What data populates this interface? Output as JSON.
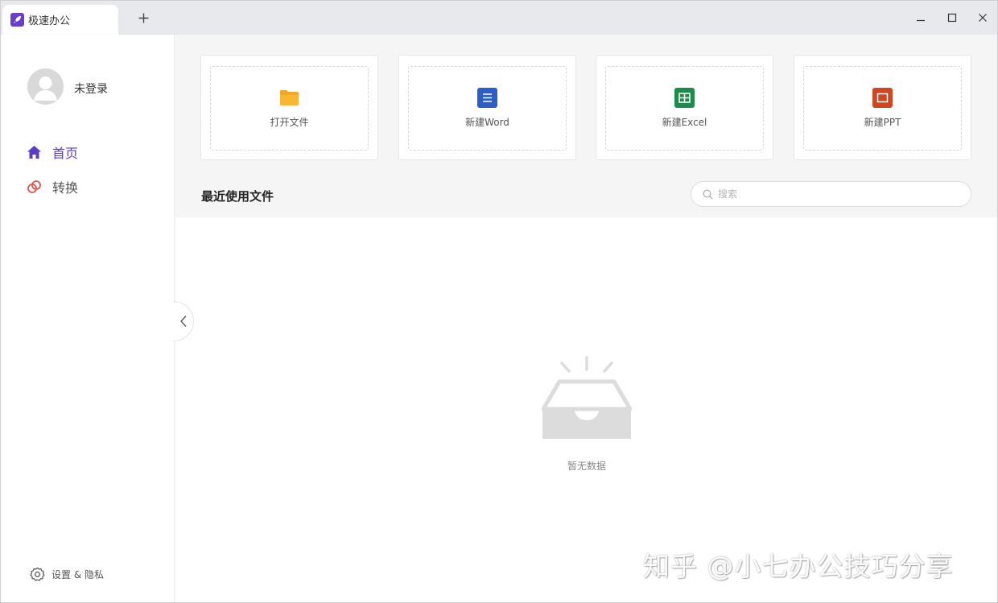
{
  "titlebar": {
    "tab_label": "极速办公",
    "new_tab_label": "+"
  },
  "sidebar": {
    "username": "未登录",
    "nav": [
      {
        "label": "首页",
        "icon": "home-icon",
        "active": true,
        "color": "#5b3cc4"
      },
      {
        "label": "转换",
        "icon": "convert-icon",
        "active": false,
        "color": "#e5534b"
      }
    ],
    "settings_label": "设置 & 隐私"
  },
  "quick_actions": [
    {
      "label": "打开文件",
      "icon": "folder-icon",
      "color": "#f5a623"
    },
    {
      "label": "新建Word",
      "icon": "word-icon",
      "color": "#2b5fc7"
    },
    {
      "label": "新建Excel",
      "icon": "excel-icon",
      "color": "#1e8a4c"
    },
    {
      "label": "新建PPT",
      "icon": "ppt-icon",
      "color": "#d2461f"
    }
  ],
  "recent": {
    "title": "最近使用文件",
    "search_placeholder": "搜索",
    "empty_text": "暂无数据"
  },
  "watermark": "知乎 @小七办公技巧分享",
  "colors": {
    "accent": "#5b3cc4",
    "app_icon": "#6a3fc8"
  }
}
